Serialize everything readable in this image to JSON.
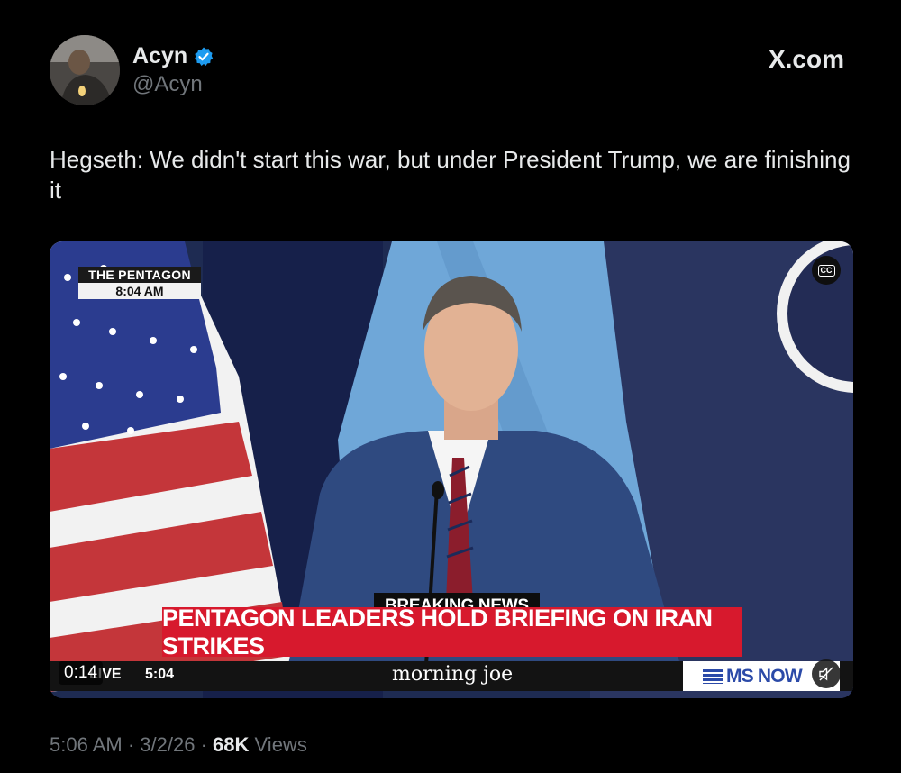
{
  "author": {
    "name": "Acyn",
    "handle": "@Acyn",
    "verified": true
  },
  "site_logo": "X.com",
  "tweet": {
    "text": "Hegseth: We didn't start this war, but under President Trump, we are finishing it"
  },
  "video": {
    "location_label": "THE PENTAGON",
    "location_time": "8:04 AM",
    "breaking_label": "BREAKING NEWS",
    "headline": "PENTAGON LEADERS HOLD BRIEFING ON IRAN STRIKES",
    "live_label": "LIVE",
    "clock_time": "5:04",
    "show_name": "morning joe",
    "network": "MS NOW",
    "elapsed": "0:14",
    "cc_label": "CC",
    "icons": [
      "closed-captions-icon",
      "mute-icon",
      "verified-badge-icon"
    ]
  },
  "meta": {
    "time": "5:06 AM",
    "date": "3/2/26",
    "views_count": "68K",
    "views_label": "Views"
  },
  "colors": {
    "accent_blue": "#1d9bf0",
    "headline_red": "#d7192d",
    "muted_text": "#71767b"
  }
}
